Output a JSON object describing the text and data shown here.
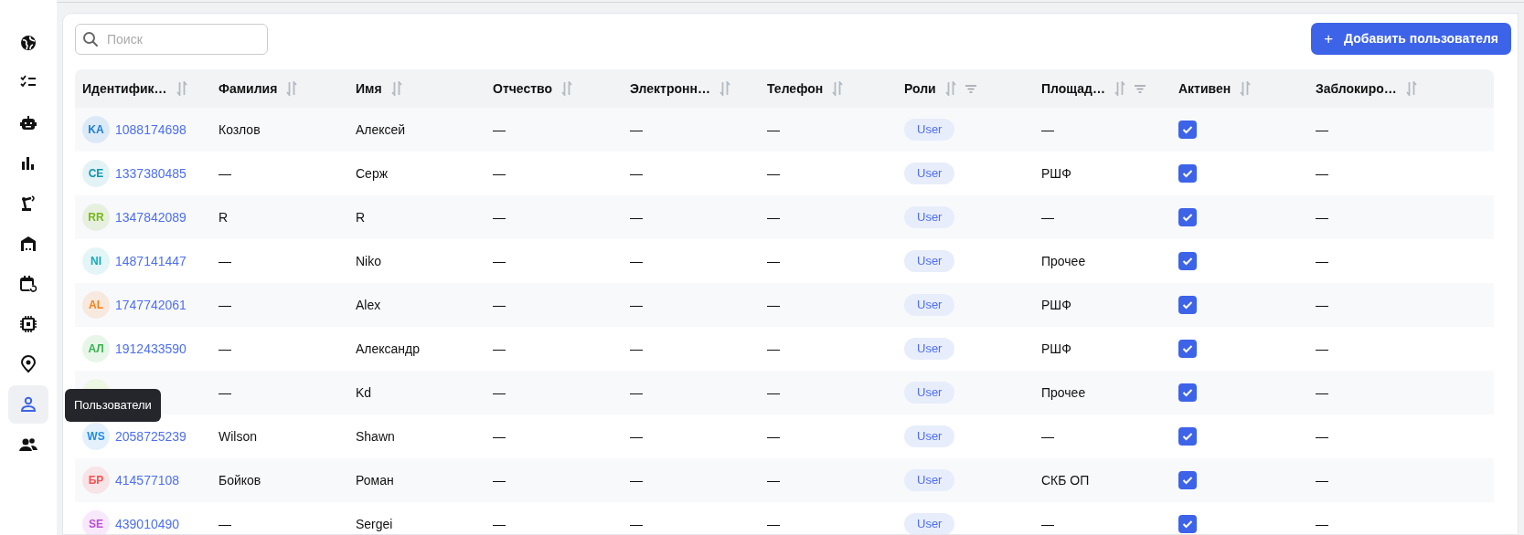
{
  "sidebar": {
    "items": [
      {
        "kind": "globe",
        "selected": false
      },
      {
        "kind": "checklist",
        "selected": false
      },
      {
        "kind": "robot",
        "selected": false
      },
      {
        "kind": "chart",
        "selected": false
      },
      {
        "kind": "arm",
        "selected": false
      },
      {
        "kind": "warehouse",
        "selected": false
      },
      {
        "kind": "calendar",
        "selected": false
      },
      {
        "kind": "chip",
        "selected": false
      },
      {
        "kind": "pin",
        "selected": false
      },
      {
        "kind": "user",
        "selected": true
      },
      {
        "kind": "users",
        "selected": false
      }
    ]
  },
  "tooltip": "Пользователи",
  "search": {
    "placeholder": "Поиск"
  },
  "add_button": {
    "icon": "+",
    "label": "Добавить пользователя"
  },
  "table": {
    "columns": [
      {
        "label": "Идентифик…",
        "sortable": true,
        "filterable": false
      },
      {
        "label": "Фамилия",
        "sortable": true,
        "filterable": false
      },
      {
        "label": "Имя",
        "sortable": true,
        "filterable": false
      },
      {
        "label": "Отчество",
        "sortable": true,
        "filterable": false
      },
      {
        "label": "Электронн…",
        "sortable": true,
        "filterable": false
      },
      {
        "label": "Телефон",
        "sortable": true,
        "filterable": false
      },
      {
        "label": "Роли",
        "sortable": true,
        "filterable": true
      },
      {
        "label": "Площад…",
        "sortable": true,
        "filterable": true
      },
      {
        "label": "Активен",
        "sortable": true,
        "filterable": false
      },
      {
        "label": "Заблокиро…",
        "sortable": true,
        "filterable": false
      }
    ],
    "rows": [
      {
        "initials": "KA",
        "color": "#1c7ed6",
        "id": "1088174698",
        "last_name": "Козлов",
        "first_name": "Алексей",
        "patronymic": "—",
        "email": "—",
        "phone": "—",
        "role": "User",
        "site": "—",
        "active": true,
        "blocked": "—"
      },
      {
        "initials": "CE",
        "color": "#1098ad",
        "id": "1337380485",
        "last_name": "—",
        "first_name": "Серж",
        "patronymic": "—",
        "email": "—",
        "phone": "—",
        "role": "User",
        "site": "РШФ",
        "active": true,
        "blocked": "—"
      },
      {
        "initials": "RR",
        "color": "#74b816",
        "id": "1347842089",
        "last_name": "R",
        "first_name": "R",
        "patronymic": "—",
        "email": "—",
        "phone": "—",
        "role": "User",
        "site": "—",
        "active": true,
        "blocked": "—"
      },
      {
        "initials": "NI",
        "color": "#15aabf",
        "id": "1487141447",
        "last_name": "—",
        "first_name": "Niko",
        "patronymic": "—",
        "email": "—",
        "phone": "—",
        "role": "User",
        "site": "Прочее",
        "active": true,
        "blocked": "—"
      },
      {
        "initials": "AL",
        "color": "#fd7e14",
        "id": "1747742061",
        "last_name": "—",
        "first_name": "Alex",
        "patronymic": "—",
        "email": "—",
        "phone": "—",
        "role": "User",
        "site": "РШФ",
        "active": true,
        "blocked": "—"
      },
      {
        "initials": "АЛ",
        "color": "#37b24d",
        "id": "1912433590",
        "last_name": "—",
        "first_name": "Александр",
        "patronymic": "—",
        "email": "—",
        "phone": "—",
        "role": "User",
        "site": "РШФ",
        "active": true,
        "blocked": "—"
      },
      {
        "last_name": "—",
        "first_name": "Kd",
        "patronymic": "—",
        "email": "—",
        "phone": "—",
        "role": "User",
        "site": "Прочее",
        "active": true,
        "blocked": "—"
      },
      {
        "initials": "WS",
        "color": "#228be6",
        "id": "2058725239",
        "last_name": "Wilson",
        "first_name": "Shawn",
        "patronymic": "—",
        "email": "—",
        "phone": "—",
        "role": "User",
        "site": "—",
        "active": true,
        "blocked": "—"
      },
      {
        "initials": "БР",
        "color": "#fa5252",
        "id": "414577108",
        "last_name": "Бойков",
        "first_name": "Роман",
        "patronymic": "—",
        "email": "—",
        "phone": "—",
        "role": "User",
        "site": "СКБ ОП",
        "active": true,
        "blocked": "—"
      },
      {
        "initials": "SE",
        "color": "#be4bdb",
        "id": "439010490",
        "last_name": "—",
        "first_name": "Sergei",
        "patronymic": "—",
        "email": "—",
        "phone": "—",
        "role": "User",
        "site": "—",
        "active": true,
        "blocked": "—"
      }
    ]
  }
}
